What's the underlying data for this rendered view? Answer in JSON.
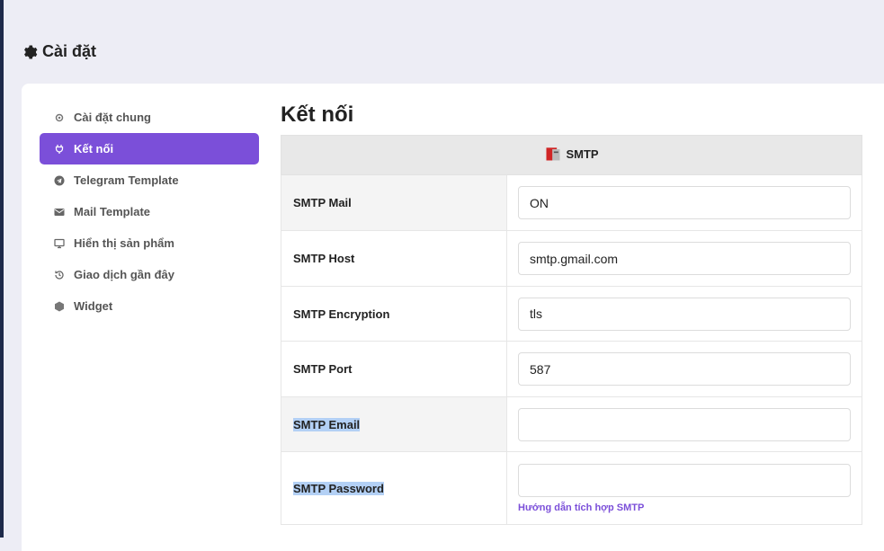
{
  "page": {
    "title": "Cài đặt",
    "title_icon": "gear-icon"
  },
  "sidebar": {
    "items": [
      {
        "label": "Cài đặt chung",
        "icon": "gear-icon"
      },
      {
        "label": "Kết nối",
        "icon": "plug-icon",
        "active": true
      },
      {
        "label": "Telegram Template",
        "icon": "telegram-icon"
      },
      {
        "label": "Mail Template",
        "icon": "envelope-icon"
      },
      {
        "label": "Hiển thị sản phẩm",
        "icon": "monitor-icon"
      },
      {
        "label": "Giao dịch gần đây",
        "icon": "history-icon"
      },
      {
        "label": "Widget",
        "icon": "widget-icon"
      }
    ]
  },
  "content": {
    "title": "Kết nối",
    "section_header": "SMTP",
    "section_icon": "smtp-logo-icon",
    "rows": [
      {
        "label": "SMTP Mail",
        "value": "ON"
      },
      {
        "label": "SMTP Host",
        "value": "smtp.gmail.com"
      },
      {
        "label": "SMTP Encryption",
        "value": "tls"
      },
      {
        "label": "SMTP Port",
        "value": "587"
      },
      {
        "label": "SMTP Email",
        "value": ""
      },
      {
        "label": "SMTP Password",
        "value": ""
      }
    ],
    "help_link": "Hướng dẫn tích hợp SMTP"
  },
  "colors": {
    "accent": "#7b4fd9",
    "background": "#ededf5",
    "selection": "#b3d0f5"
  }
}
